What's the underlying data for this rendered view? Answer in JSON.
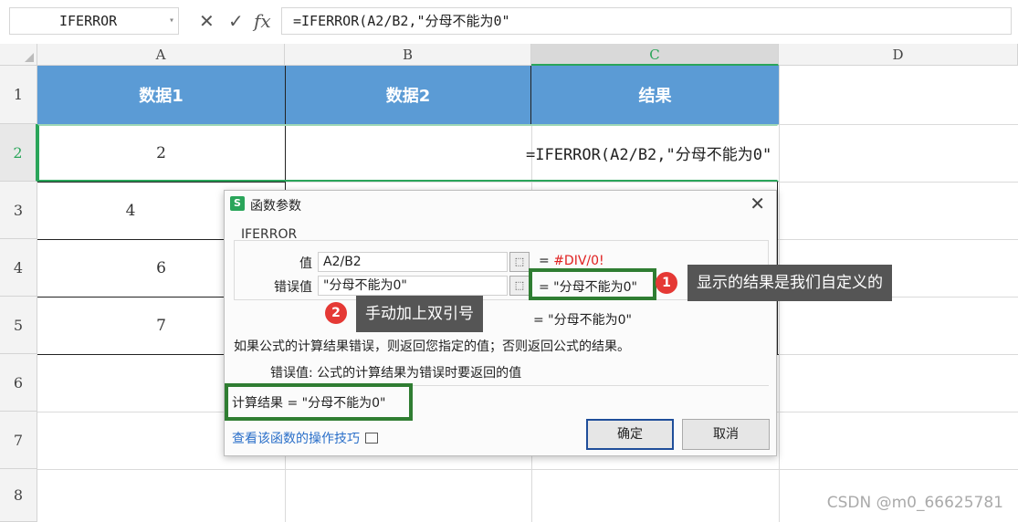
{
  "formula_bar": {
    "name_box": "IFERROR",
    "formula": "=IFERROR(A2/B2,\"分母不能为0\"",
    "cancel_icon": "close-icon",
    "confirm_icon": "check-icon",
    "fx_label": "fx"
  },
  "columns": [
    "A",
    "B",
    "C",
    "D"
  ],
  "rows": [
    "1",
    "2",
    "3",
    "4",
    "5",
    "6",
    "7",
    "8"
  ],
  "table": {
    "headers": [
      "数据1",
      "数据2",
      "结果"
    ],
    "col_a_values": [
      "2",
      "4",
      "6",
      "7"
    ],
    "c2_formula": "=IFERROR(A2/B2,\"分母不能为0\""
  },
  "dialog": {
    "title": "函数参数",
    "function_name": "IFERROR",
    "params": [
      {
        "label": "值",
        "value": "A2/B2",
        "result": "= ",
        "result_value": "#DIV/0!"
      },
      {
        "label": "错误值",
        "value": "\"分母不能为0\"",
        "result": "= \"分母不能为0\""
      }
    ],
    "function_result": "= \"分母不能为0\"",
    "description": "如果公式的计算结果错误，则返回您指定的值；否则返回公式的结果。",
    "arg_description": "错误值:  公式的计算结果为错误时要返回的值",
    "calc_result": "计算结果 = \"分母不能为0\"",
    "help_link": "查看该函数的操作技巧",
    "ok_label": "确定",
    "cancel_label": "取消",
    "logo": "S",
    "close": "✕"
  },
  "annotations": {
    "badge1": "1",
    "callout1": "显示的结果是我们自定义的",
    "badge2": "2",
    "callout2": "手动加上双引号"
  },
  "watermark": "CSDN @m0_66625781",
  "colors": {
    "accent": "#2aa55a",
    "header_fill": "#5b9bd5",
    "annotation_green": "#2f7d32",
    "badge_red": "#e53935"
  }
}
